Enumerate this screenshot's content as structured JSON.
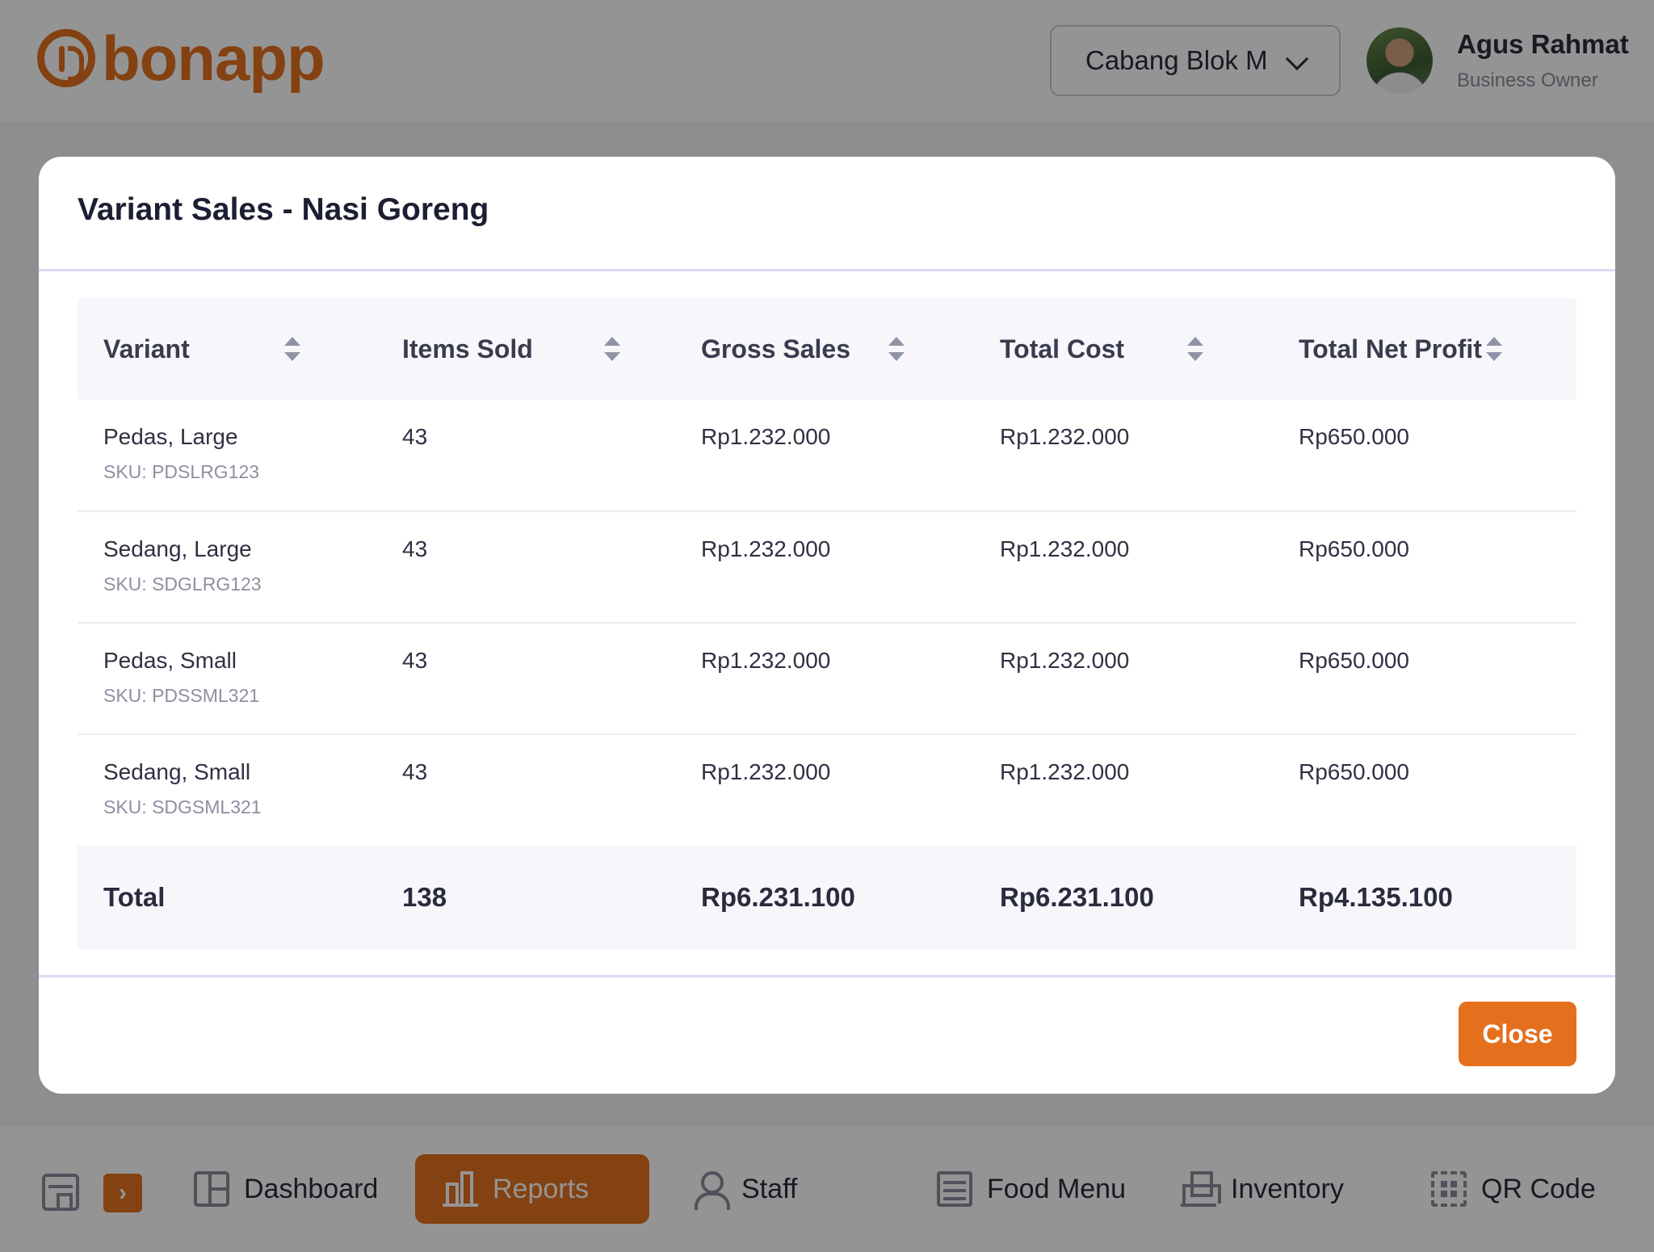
{
  "brand": {
    "name": "bonapp",
    "accent": "#e4701e"
  },
  "header": {
    "branch_selector": "Cabang Blok M",
    "user": {
      "name": "Agus Rahmat",
      "role": "Business Owner"
    }
  },
  "bottom_nav": {
    "items": [
      {
        "label": "Dashboard",
        "icon": "dashboard-icon"
      },
      {
        "label": "Reports",
        "icon": "bar-chart-icon",
        "active": true
      },
      {
        "label": "Staff",
        "icon": "user-icon"
      },
      {
        "label": "Food Menu",
        "icon": "menu-list-icon"
      },
      {
        "label": "Inventory",
        "icon": "boxes-icon"
      },
      {
        "label": "QR Code",
        "icon": "qr-code-icon"
      }
    ]
  },
  "modal": {
    "title": "Variant Sales - Nasi Goreng",
    "columns": [
      "Variant",
      "Items Sold",
      "Gross Sales",
      "Total Cost",
      "Total Net Profit"
    ],
    "rows": [
      {
        "variant": "Pedas, Large",
        "sku": "SKU: PDSLRG123",
        "items_sold": "43",
        "gross_sales": "Rp1.232.000",
        "total_cost": "Rp1.232.000",
        "net_profit": "Rp650.000"
      },
      {
        "variant": "Sedang, Large",
        "sku": "SKU: SDGLRG123",
        "items_sold": "43",
        "gross_sales": "Rp1.232.000",
        "total_cost": "Rp1.232.000",
        "net_profit": "Rp650.000"
      },
      {
        "variant": "Pedas, Small",
        "sku": "SKU: PDSSML321",
        "items_sold": "43",
        "gross_sales": "Rp1.232.000",
        "total_cost": "Rp1.232.000",
        "net_profit": "Rp650.000"
      },
      {
        "variant": "Sedang, Small",
        "sku": "SKU: SDGSML321",
        "items_sold": "43",
        "gross_sales": "Rp1.232.000",
        "total_cost": "Rp1.232.000",
        "net_profit": "Rp650.000"
      }
    ],
    "total": {
      "label": "Total",
      "items_sold": "138",
      "gross_sales": "Rp6.231.100",
      "total_cost": "Rp6.231.100",
      "net_profit": "Rp4.135.100"
    },
    "close_label": "Close"
  }
}
